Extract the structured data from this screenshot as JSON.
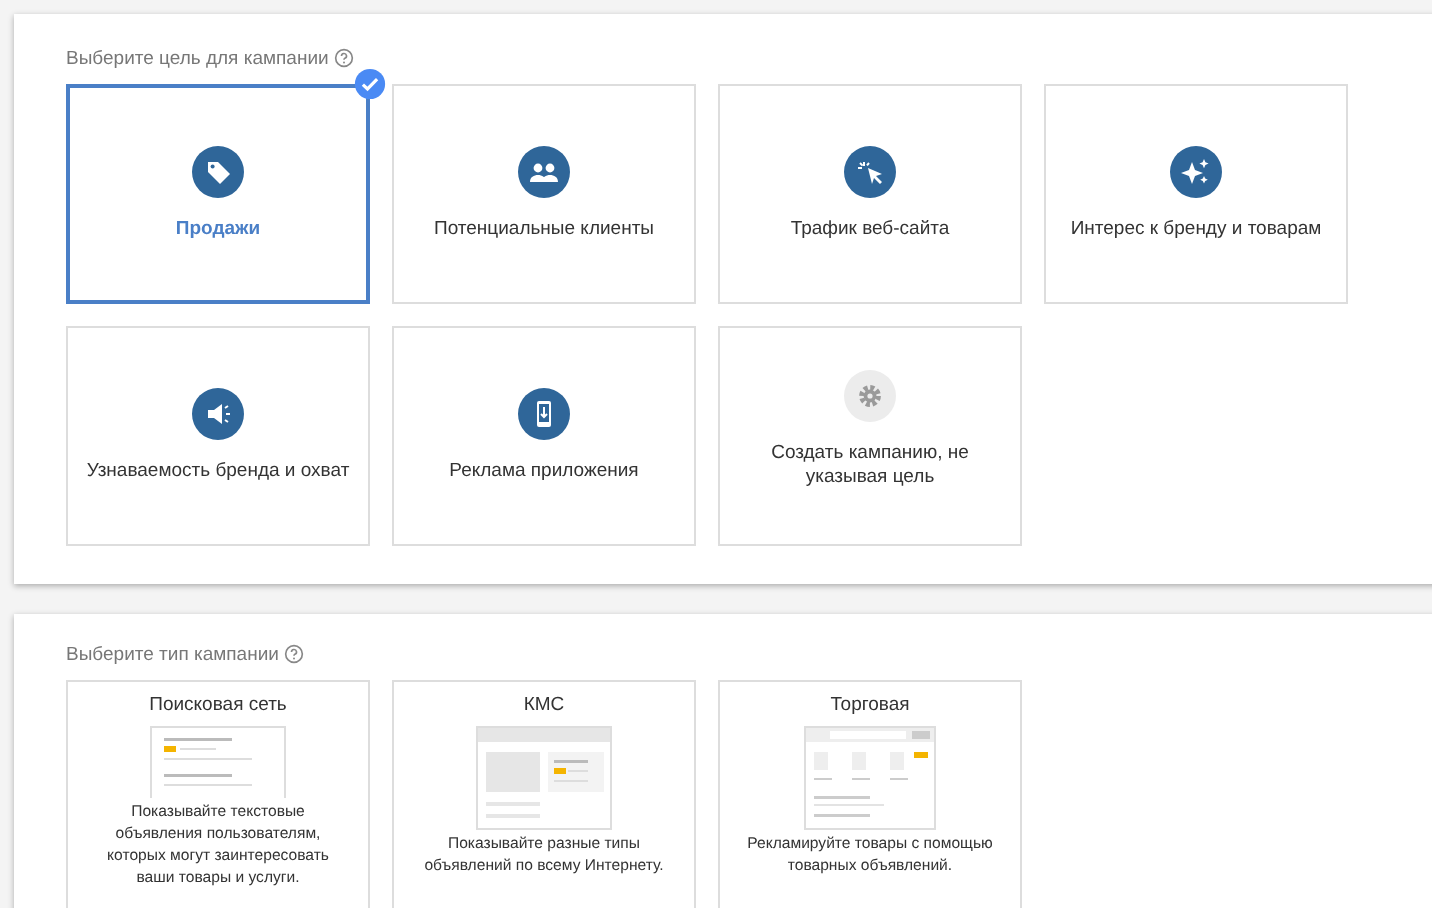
{
  "goal_section": {
    "heading": "Выберите цель для кампании",
    "goals": [
      {
        "label": "Продажи",
        "selected": true,
        "kind": "goal"
      },
      {
        "label": "Потенциальные клиенты",
        "selected": false,
        "kind": "goal"
      },
      {
        "label": "Трафик веб-сайта",
        "selected": false,
        "kind": "goal"
      },
      {
        "label": "Интерес к бренду и товарам",
        "selected": false,
        "kind": "goal"
      },
      {
        "label": "Узнаваемость бренда и охват",
        "selected": false,
        "kind": "goal"
      },
      {
        "label": "Реклама приложения",
        "selected": false,
        "kind": "goal"
      },
      {
        "label": "Создать кампанию, не указывая цель",
        "selected": false,
        "kind": "no_goal"
      }
    ]
  },
  "type_section": {
    "heading": "Выберите тип кампании",
    "types": [
      {
        "title": "Поисковая сеть",
        "kind": "search",
        "description": "Показывайте текстовые объявления пользователям, которых могут заинтересовать ваши товары и услуги."
      },
      {
        "title": "КМС",
        "kind": "display",
        "description": "Показывайте разные типы объявлений по всему Интернету."
      },
      {
        "title": "Торговая",
        "kind": "shopping",
        "description": "Рекламируйте товары с помощью товарных объявлений."
      }
    ]
  }
}
